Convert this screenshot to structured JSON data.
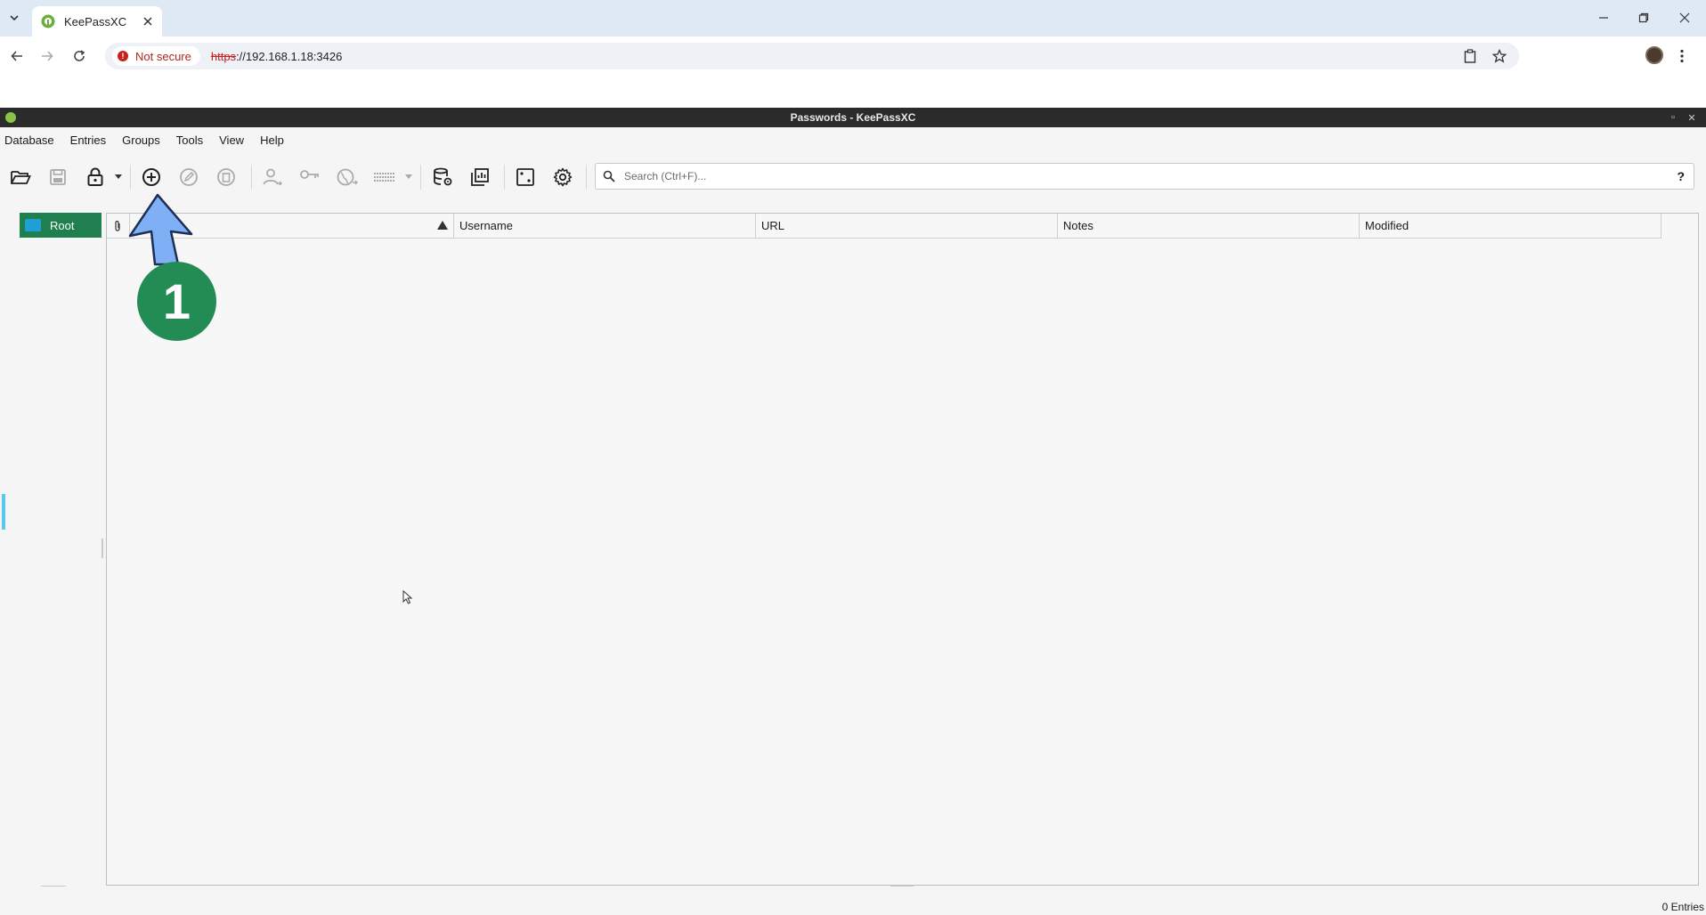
{
  "browser": {
    "tab": {
      "title": "KeePassXC"
    },
    "address": {
      "security_label": "Not secure",
      "scheme": "https",
      "rest": "://192.168.1.18:3426"
    }
  },
  "window": {
    "title": "Passwords - KeePassXC"
  },
  "menu": {
    "items": [
      "Database",
      "Entries",
      "Groups",
      "Tools",
      "View",
      "Help"
    ]
  },
  "toolbar": {
    "buttons": [
      {
        "name": "open-database",
        "icon": "folder-open-icon"
      },
      {
        "name": "save-database",
        "icon": "save-icon"
      },
      {
        "name": "lock-database",
        "icon": "lock-icon"
      },
      {
        "name": "add-entry",
        "icon": "plus-circle-icon"
      },
      {
        "name": "edit-entry",
        "icon": "pencil-icon"
      },
      {
        "name": "delete-entry",
        "icon": "trash-icon"
      },
      {
        "name": "copy-username",
        "icon": "user-copy-icon"
      },
      {
        "name": "copy-password",
        "icon": "key-icon"
      },
      {
        "name": "open-url",
        "icon": "globe-icon"
      },
      {
        "name": "autotype",
        "icon": "keyboard-icon"
      },
      {
        "name": "database-settings",
        "icon": "database-gear-icon"
      },
      {
        "name": "reports",
        "icon": "reports-icon"
      },
      {
        "name": "password-generator",
        "icon": "dice-icon"
      },
      {
        "name": "settings",
        "icon": "gear-icon"
      }
    ],
    "search_placeholder": "Search (Ctrl+F)...",
    "help_label": "?"
  },
  "groups": {
    "root_label": "Root"
  },
  "table": {
    "headers": {
      "username": "Username",
      "url": "URL",
      "notes": "Notes",
      "modified": "Modified"
    }
  },
  "status": {
    "entries": "0 Entries"
  },
  "annotation": {
    "step": "1",
    "arrow_color": "#7fb0f5",
    "badge_color": "#238c55"
  }
}
